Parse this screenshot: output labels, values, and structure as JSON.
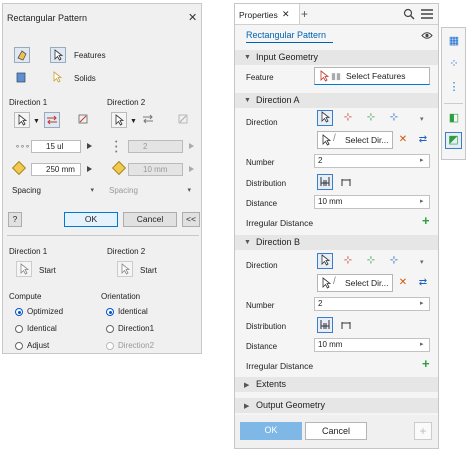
{
  "dialog": {
    "title": "Rectangular Pattern",
    "close": "✕",
    "features_label": "Features",
    "solids_label": "Solids",
    "direction1": {
      "title": "Direction 1",
      "count": "15 ul",
      "spacing": "250 mm",
      "method": "Spacing"
    },
    "direction2": {
      "title": "Direction 2",
      "count": "2",
      "spacing": "10 mm",
      "method": "Spacing"
    },
    "ok": "OK",
    "cancel": "Cancel",
    "more": "<<",
    "help": "?",
    "start1": {
      "title": "Direction 1",
      "label": "Start"
    },
    "start2": {
      "title": "Direction 2",
      "label": "Start"
    },
    "compute": {
      "title": "Compute",
      "options": [
        "Optimized",
        "Identical",
        "Adjust"
      ],
      "selected": "Optimized"
    },
    "orientation": {
      "title": "Orientation",
      "options": [
        "Identical",
        "Direction1",
        "Direction2"
      ],
      "selected": "Identical"
    }
  },
  "panel": {
    "tab_label": "Properties",
    "tab_close": "✕",
    "tab_add": "+",
    "feature_name": "Rectangular Pattern",
    "input_geometry": {
      "title": "Input Geometry",
      "feature_label": "Feature",
      "feature_button": "Select Features"
    },
    "direction_a": {
      "title": "Direction A",
      "direction_label": "Direction",
      "select_dir": "Select Dir...",
      "number_label": "Number",
      "number_value": "2",
      "distribution_label": "Distribution",
      "distance_label": "Distance",
      "distance_value": "10 mm",
      "irregular_label": "Irregular Distance"
    },
    "direction_b": {
      "title": "Direction B",
      "direction_label": "Direction",
      "select_dir": "Select Dir...",
      "number_label": "Number",
      "number_value": "2",
      "distribution_label": "Distribution",
      "distance_label": "Distance",
      "distance_value": "10 mm",
      "irregular_label": "Irregular Distance"
    },
    "extents": {
      "title": "Extents"
    },
    "output_geometry": {
      "title": "Output Geometry"
    },
    "ok": "OK",
    "cancel": "Cancel",
    "add": "+"
  },
  "colors": {
    "accent": "#0078d7",
    "ok_disabled": "#7fb7e6",
    "link": "#0063b1",
    "plus_green": "#2e9e3e"
  }
}
